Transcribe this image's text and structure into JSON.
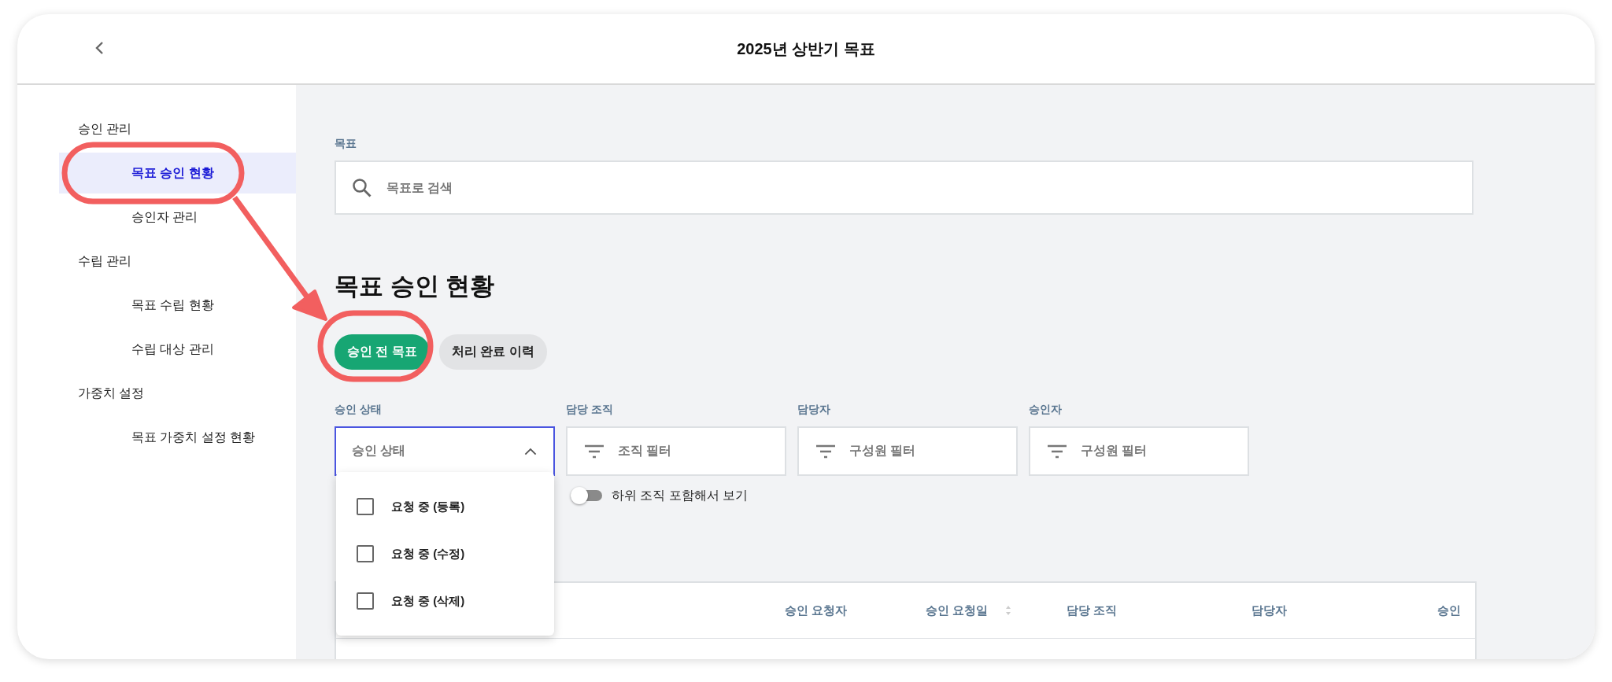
{
  "header": {
    "title": "2025년 상반기 목표"
  },
  "sidebar": {
    "groups": [
      {
        "label": "승인 관리",
        "children": [
          {
            "label": "목표 승인 현황",
            "selected": true
          },
          {
            "label": "승인자 관리",
            "selected": false
          }
        ]
      },
      {
        "label": "수립 관리",
        "children": [
          {
            "label": "목표 수립 현황",
            "selected": false
          },
          {
            "label": "수립 대상 관리",
            "selected": false
          }
        ]
      },
      {
        "label": "가중치 설정",
        "children": [
          {
            "label": "목표 가중치 설정 현황",
            "selected": false
          }
        ]
      }
    ]
  },
  "search": {
    "label": "목표",
    "placeholder": "목표로 검색"
  },
  "page_title": "목표 승인 현황",
  "tabs": [
    {
      "label": "승인 전 목표",
      "selected": true
    },
    {
      "label": "처리 완료 이력",
      "selected": false
    }
  ],
  "filters": [
    {
      "kind": "select",
      "label": "승인 상태",
      "placeholder": "승인 상태",
      "expanded": true,
      "options": [
        {
          "label": "요청 중 (등록)",
          "checked": false
        },
        {
          "label": "요청 중 (수정)",
          "checked": false
        },
        {
          "label": "요청 중 (삭제)",
          "checked": false
        }
      ]
    },
    {
      "kind": "filter",
      "label": "담당 조직",
      "placeholder": "조직 필터"
    },
    {
      "kind": "filter",
      "label": "담당자",
      "placeholder": "구성원 필터"
    },
    {
      "kind": "filter",
      "label": "승인자",
      "placeholder": "구성원 필터"
    }
  ],
  "toggle": {
    "label": "하위 조직 포함해서 보기",
    "on": false
  },
  "table": {
    "columns": [
      {
        "label": "승인 요청자",
        "sortable": false
      },
      {
        "label": "승인 요청일",
        "sortable": true
      },
      {
        "label": "담당 조직",
        "sortable": false
      },
      {
        "label": "담당자",
        "sortable": false
      },
      {
        "label": "승인",
        "sortable": false
      }
    ]
  }
}
